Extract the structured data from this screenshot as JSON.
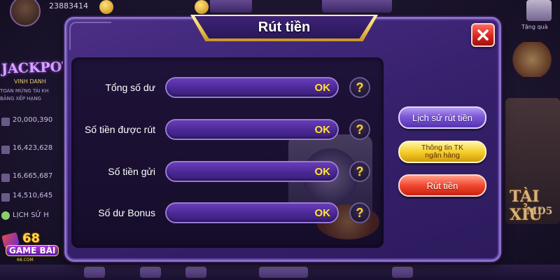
{
  "background": {
    "player_id": "23883414",
    "jackpot_title": "JACKPOT",
    "vinh_danh": "VINH DANH",
    "vinh_danh_line1": "TOÀN MỪNG TÀI KH",
    "vinh_danh_line2": "BẢNG XẾP HẠNG",
    "scores": [
      "20,000,390",
      "16,423,628",
      "16,665,687",
      "14,510,645"
    ],
    "history_label": "LỊCH SỬ H",
    "right_top_label": "Tặng quà",
    "right_game_title": "TÀI XỈU",
    "right_game_sub": "MD5",
    "logo_number": "68",
    "logo_text": "GAME BÀI",
    "logo_sub": "68.COM"
  },
  "dialog": {
    "title": "Rút tiền",
    "close_icon": "close-icon",
    "rows": [
      {
        "label": "Tổng số dư",
        "value": "OK",
        "help": "?"
      },
      {
        "label": "Số tiền được rút",
        "value": "OK",
        "help": "?"
      },
      {
        "label": "Số tiền gửi",
        "value": "OK",
        "help": "?"
      },
      {
        "label": "Số dư Bonus",
        "value": "OK",
        "help": "?"
      }
    ],
    "buttons": {
      "history": "Lịch sử rút tiền",
      "bank_info_line1": "Thông tin TK",
      "bank_info_line2": "ngân hàng",
      "withdraw": "Rút tiền"
    }
  },
  "colors": {
    "panel_purple": "#35206b",
    "title_gold": "#f2cf5b",
    "value_yellow": "#ffe24a",
    "close_red": "#d9261f"
  }
}
